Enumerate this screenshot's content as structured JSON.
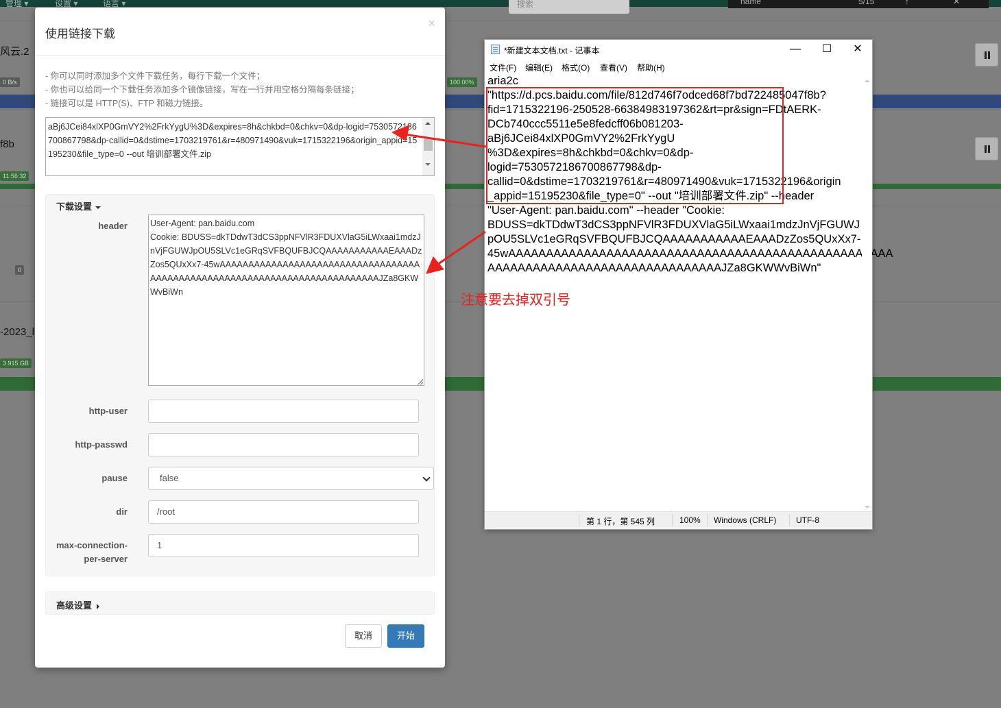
{
  "background_app": {
    "nav_items": [
      "管理 ▾",
      "设置 ▾",
      "语言 ▾"
    ],
    "search_placeholder": "搜索",
    "header_cells": [
      "name",
      "5/15",
      "↑",
      "✕"
    ],
    "rows": [
      {
        "name": "风云.2",
        "badge": "0 B/s",
        "badge2": "100.00%"
      },
      {
        "name": "f8b",
        "badge": "11:56:32"
      },
      {
        "name": "0",
        "badge": "0"
      },
      {
        "name": "-2023_l",
        "badge": "3.915 GB"
      }
    ]
  },
  "modal": {
    "title": "使用链接下载",
    "close_icon": "×",
    "tips": [
      "- 你可以同时添加多个文件下载任务，每行下载一个文件；",
      "- 你也可以给同一个下载任务添加多个镜像链接，写在一行并用空格分隔每条链接；",
      "- 链接可以是 HTTP(S)、FTP 和磁力链接。"
    ],
    "urls_text": "aBj6JCei84xlXP0GmVY2%2FrkYygU%3D&expires=8h&chkbd=0&chkv=0&dp-logid=7530572186700867798&dp-callid=0&dstime=1703219761&r=480971490&vuk=1715322196&origin_appid=15195230&file_type=0 --out 培训部署文件.zip",
    "download_settings": {
      "title": "下载设置",
      "header_label": "header",
      "header_value": "User-Agent: pan.baidu.com\nCookie: BDUSS=dkTDdwT3dCS3ppNFVlR3FDUXVlaG5iLWxaai1mdzJnVjFGUWJpOU5SLVc1eGRqSVFBQUFBJCQAAAAAAAAAAAEAAADzZos5QUxXx7-45wAAAAAAAAAAAAAAAAAAAAAAAAAAAAAAAAAAAAAAAAAAAAAAAAAAAAAAAAAAAAAAAAAAAAAAAAAAAJZa8GKWWvBiWn",
      "http_user_label": "http-user",
      "http_user_value": "",
      "http_passwd_label": "http-passwd",
      "http_passwd_value": "",
      "pause_label": "pause",
      "pause_value": "false",
      "dir_label": "dir",
      "dir_value": "/root",
      "maxconn_label_1": "max-connection-",
      "maxconn_label_2": "per-server",
      "maxconn_value": "1"
    },
    "advanced_settings": {
      "title": "高级设置"
    },
    "cancel_label": "取消",
    "start_label": "开始"
  },
  "notepad": {
    "title": "*新建文本文档.txt - 记事本",
    "window_buttons": {
      "minimize": "—",
      "maximize": "☐",
      "close": "✕"
    },
    "menu": [
      "文件(F)",
      "编辑(E)",
      "格式(O)",
      "查看(V)",
      "帮助(H)"
    ],
    "lines": [
      "aria2c",
      "\"https://d.pcs.baidu.com/file/812d746f7odced68f7bd722485047f8b?",
      "fid=1715322196-250528-66384983197362&rt=pr&sign=FDtAERK-",
      "DCb740ccc5511e5e8fedcff06b081203-",
      "aBj6JCei84xlXP0GmVY2%2FrkYygU",
      "%3D&expires=8h&chkbd=0&chkv=0&dp-",
      "logid=7530572186700867798&dp-",
      "callid=0&dstime=1703219761&r=480971490&vuk=1715322196&origin",
      "_appid=15195230&file_type=0\" --out \"培训部署文件.zip\" --header",
      "\"User-Agent: pan.baidu.com\" --header \"Cookie:",
      "BDUSS=dkTDdwT3dCS3ppNFVlR3FDUXVlaG5iLWxaai1mdzJnVjFGUWJ",
      "pOU5SLVc1eGRqSVFBQUFBJCQAAAAAAAAAAAEAAADzZos5QUxXx7-",
      "45wAAAAAAAAAAAAAAAAAAAAAAAAAAAAAAAAAAAAAAAAAAAAAAAAAAA",
      "AAAAAAAAAAAAAAAAAAAAAAAAAAAAAAAJZa8GKWWvBiWn\""
    ],
    "status": {
      "position": "第 1 行，第 545 列",
      "zoom": "100%",
      "line_ending": "Windows (CRLF)",
      "encoding": "UTF-8"
    }
  },
  "annotation": {
    "note": "注意要去掉双引号",
    "color": "#e8231f"
  }
}
